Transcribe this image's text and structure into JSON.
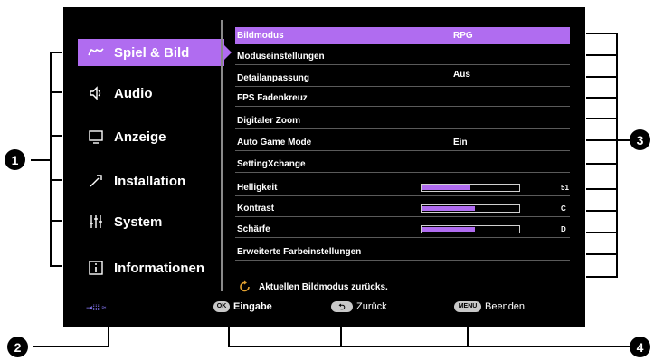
{
  "menu": {
    "items": [
      {
        "label": "Spiel & Bild",
        "icon": "gamepad-icon",
        "active": true
      },
      {
        "label": "Audio",
        "icon": "speaker-icon",
        "active": false
      },
      {
        "label": "Anzeige",
        "icon": "monitor-icon",
        "active": false
      },
      {
        "label": "Installation",
        "icon": "tools-icon",
        "active": false
      },
      {
        "label": "System",
        "icon": "sliders-icon",
        "active": false
      },
      {
        "label": "Informationen",
        "icon": "info-icon",
        "active": false
      }
    ]
  },
  "settings": {
    "rows": [
      {
        "label": "Bildmodus",
        "value": "RPG"
      },
      {
        "label": "Moduseinstellungen",
        "value": ""
      },
      {
        "label": "Detailanpassung",
        "value": "Aus"
      },
      {
        "label": "FPS Fadenkreuz",
        "value": ""
      },
      {
        "label": "Digitaler Zoom",
        "value": ""
      },
      {
        "label": "Auto Game Mode",
        "value": "Ein"
      },
      {
        "label": "SettingXchange",
        "value": ""
      },
      {
        "label": "Helligkeit",
        "value": "",
        "level": 0.5
      },
      {
        "label": "Kontrast",
        "value": "",
        "level": 0.55
      },
      {
        "label": "Schärfe",
        "value": "",
        "level": 0.55
      },
      {
        "label": "Erweiterte Farbeinstellungen",
        "value": ""
      }
    ],
    "slider_readouts": [
      "51",
      "C",
      "D"
    ],
    "reset_label": "Aktuellen Bildmodus zurücks."
  },
  "bottom_bar": {
    "source_label": "⇥⁞⁞⁞ ≈",
    "ok_key": "OK",
    "ok_label": "Eingabe",
    "back_key": "⮌",
    "back_label": "Zurück",
    "menu_key": "MENU",
    "menu_label": "Beenden"
  },
  "callouts": {
    "one": "1",
    "two": "2",
    "three": "3",
    "four": "4"
  },
  "colors": {
    "accent": "#b06cf0",
    "osd_bg": "#000000",
    "separator": "#5a5a5a"
  }
}
